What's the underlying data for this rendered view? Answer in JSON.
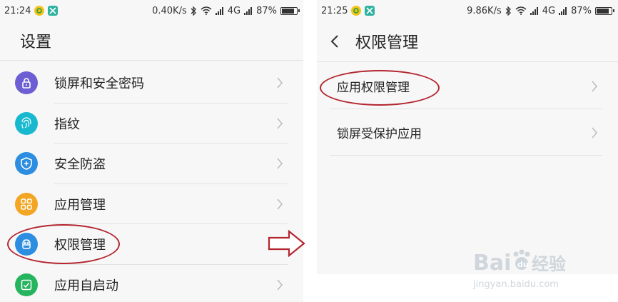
{
  "left": {
    "status": {
      "time": "21:24",
      "speed": "0.40K/s",
      "network": "4G",
      "battery": "87%",
      "battery_level": 0.87
    },
    "title": "设置",
    "items": [
      {
        "label": "锁屏和安全密码",
        "icon": "lock-icon",
        "color": "#6b5fd3"
      },
      {
        "label": "指纹",
        "icon": "fingerprint-icon",
        "color": "#18b9cf"
      },
      {
        "label": "安全防盗",
        "icon": "shield-icon",
        "color": "#2d8de0"
      },
      {
        "label": "应用管理",
        "icon": "grid-icon",
        "color": "#f2a623"
      },
      {
        "label": "权限管理",
        "icon": "android-icon",
        "color": "#2d8de0"
      },
      {
        "label": "应用自启动",
        "icon": "check-icon",
        "color": "#27b45e"
      }
    ]
  },
  "right": {
    "status": {
      "time": "21:25",
      "speed": "9.86K/s",
      "network": "4G",
      "battery": "87%",
      "battery_level": 0.87
    },
    "title": "权限管理",
    "items": [
      {
        "label": "应用权限管理"
      },
      {
        "label": "锁屏受保护应用"
      }
    ]
  },
  "watermark": {
    "brand": "Bai",
    "brand2": "du",
    "suffix": "经验",
    "url": "jingyan.baidu.com"
  },
  "colors": {
    "annotation": "#b3262f",
    "background": "#f7f7f7"
  }
}
